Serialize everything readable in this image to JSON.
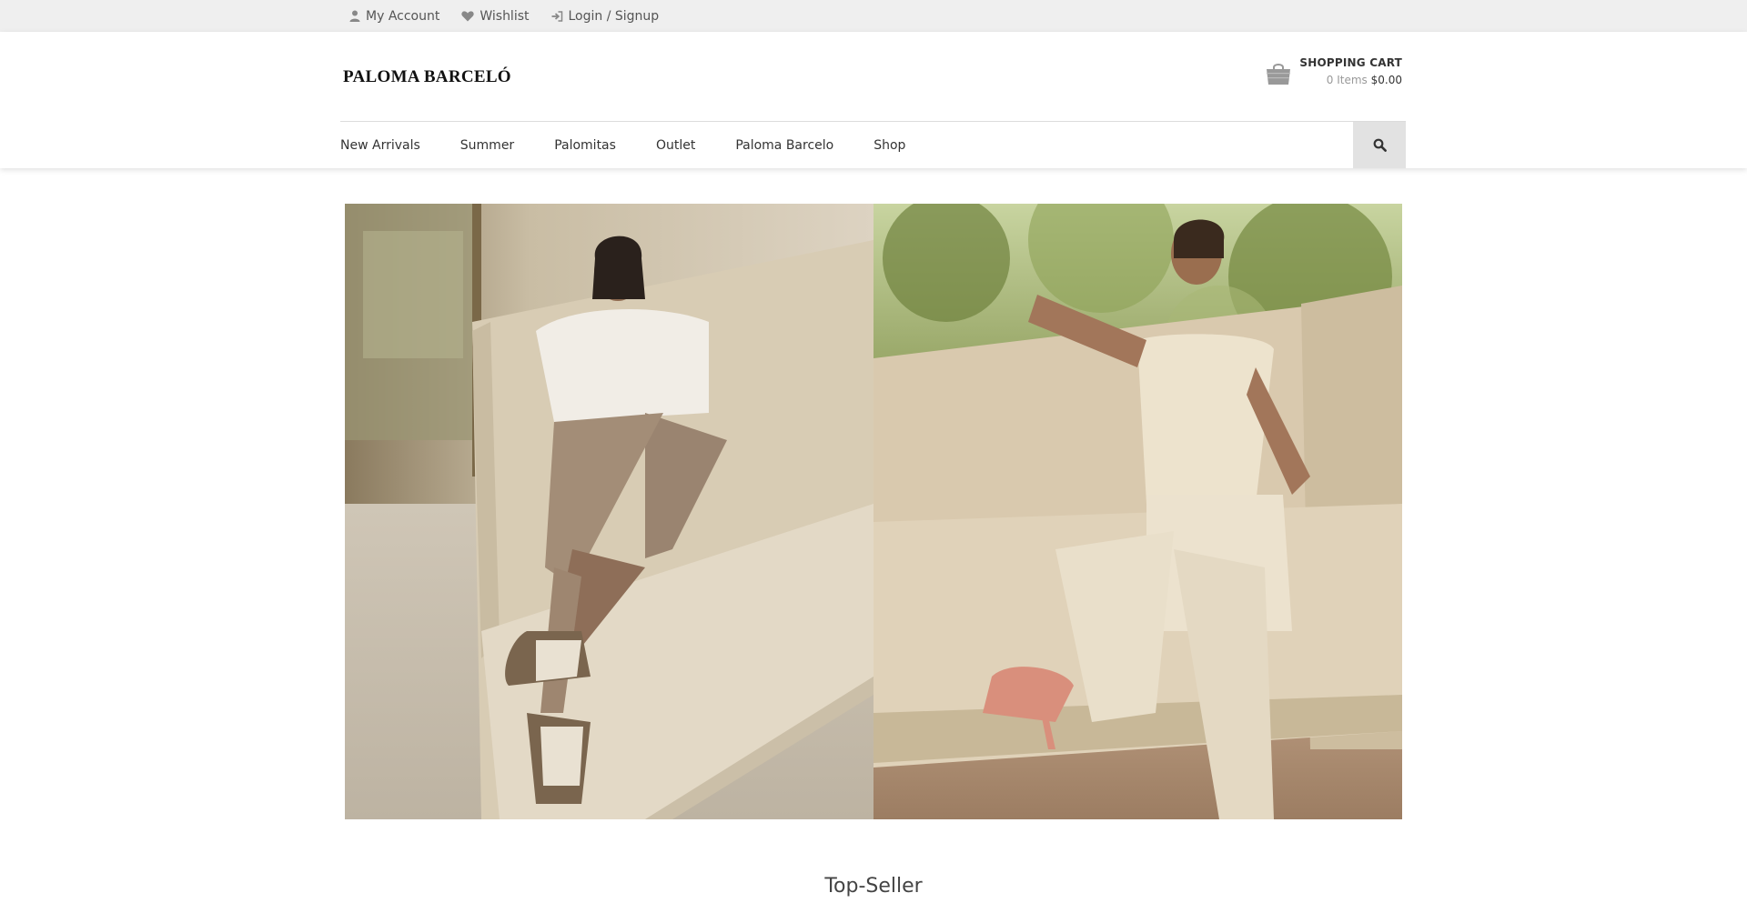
{
  "topbar": {
    "links": [
      {
        "label": "My Account",
        "icon": "user-icon"
      },
      {
        "label": "Wishlist",
        "icon": "heart-icon"
      },
      {
        "label": "Login / Signup",
        "icon": "sign-in-icon"
      }
    ]
  },
  "header": {
    "logo": "PALOMA BARCELÓ",
    "cart": {
      "title": "SHOPPING CART",
      "items": "0 Items",
      "total": "$0.00",
      "icon": "shopping-bag-icon"
    }
  },
  "nav": {
    "items": [
      "New Arrivals",
      "Summer",
      "Palomitas",
      "Outlet",
      "Paloma Barcelo",
      "Shop"
    ],
    "search_icon": "search-icon"
  },
  "hero": {
    "images": [
      {
        "alt": "model-seated-cream-sofa-wedge-sandals"
      },
      {
        "alt": "model-seated-cream-sofa-pink-heels"
      }
    ]
  },
  "sections": {
    "top_seller_title": "Top-Seller"
  },
  "colors": {
    "topbar_bg": "#efefef",
    "search_bg": "#e2e2e2",
    "text": "#333333",
    "muted": "#999999"
  }
}
